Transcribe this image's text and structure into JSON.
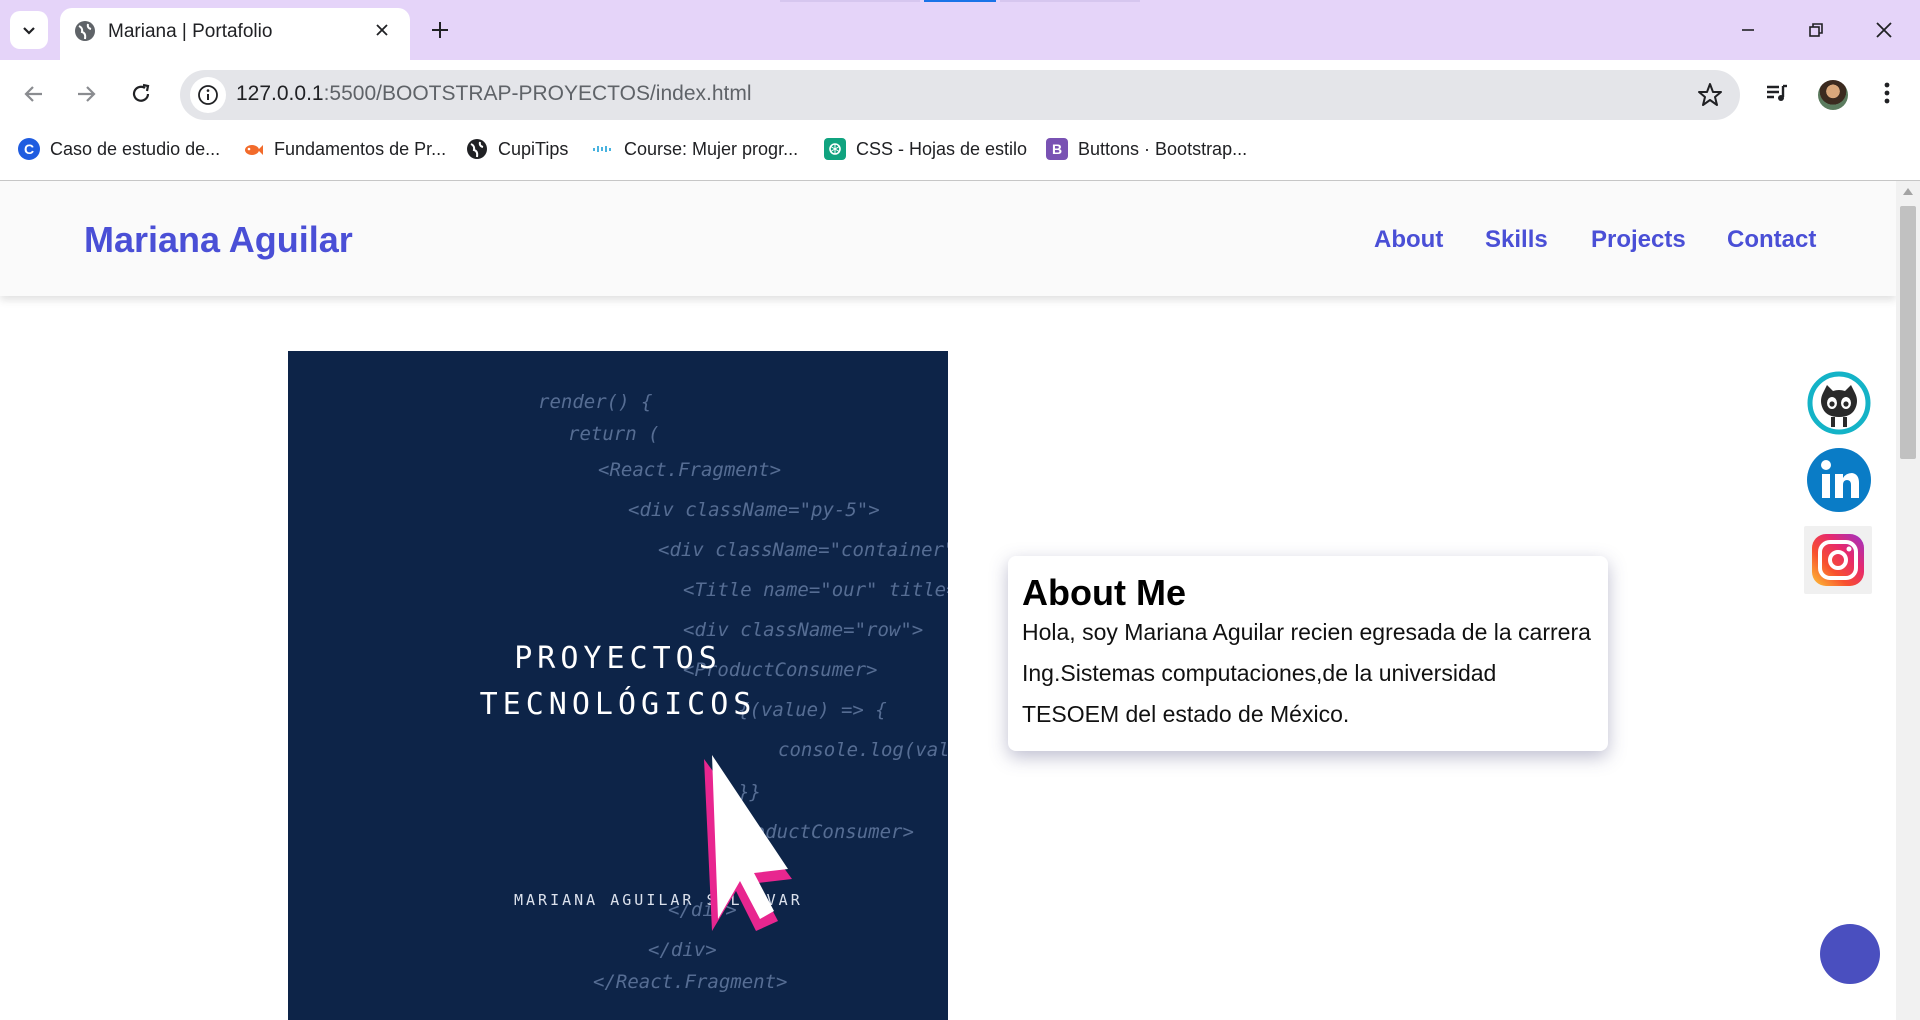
{
  "browser": {
    "tab_title": "Mariana | Portafolio",
    "url_host": "127.0.0.1",
    "url_path": ":5500/BOOTSTRAP-PROYECTOS/index.html",
    "bookmarks": [
      {
        "label": "Caso de estudio de...",
        "icon": "coursera-icon",
        "color": "#1f5ce0"
      },
      {
        "label": "Fundamentos de Pr...",
        "icon": "fish-icon",
        "color": "#f26b2b"
      },
      {
        "label": "CupiTips",
        "icon": "globe-icon",
        "color": "#202124"
      },
      {
        "label": "Course: Mujer progr...",
        "icon": "cisco-icon",
        "color": "#1ba0d7"
      },
      {
        "label": "CSS - Hojas de estilo",
        "icon": "openai-icon",
        "color": "#10a37f"
      },
      {
        "label": "Buttons · Bootstrap...",
        "icon": "bootstrap-icon",
        "color": "#7952b3"
      }
    ]
  },
  "site": {
    "brand": "Mariana Aguilar",
    "nav": [
      "About",
      "Skills",
      "Projects",
      "Contact"
    ],
    "accent": "#4a4fd6"
  },
  "hero": {
    "title_line1": "PROYECTOS",
    "title_line2": "TECNOLÓGICOS",
    "subtitle": "MARIANA AGUILAR SALDIVAR",
    "code_lines": [
      "render() {",
      "return (",
      "<React.Fragment>",
      "<div className=\"py-5\">",
      "<div className=\"container\">",
      "<Title name=\"our\" title= \"product",
      "<div className=\"row\">",
      "<ProductConsumer>",
      "{(value) => {",
      "console.log(value)",
      "}}",
      "</ProductConsumer>",
      "</div>",
      "</div>",
      "</React.Fragment>"
    ]
  },
  "about": {
    "heading": "About Me",
    "text": "Hola, soy Mariana Aguilar recien egresada de la carrera Ing.Sistemas computaciones,de la universidad TESOEM del estado de México."
  },
  "social": [
    "github-icon",
    "linkedin-icon",
    "instagram-icon"
  ]
}
